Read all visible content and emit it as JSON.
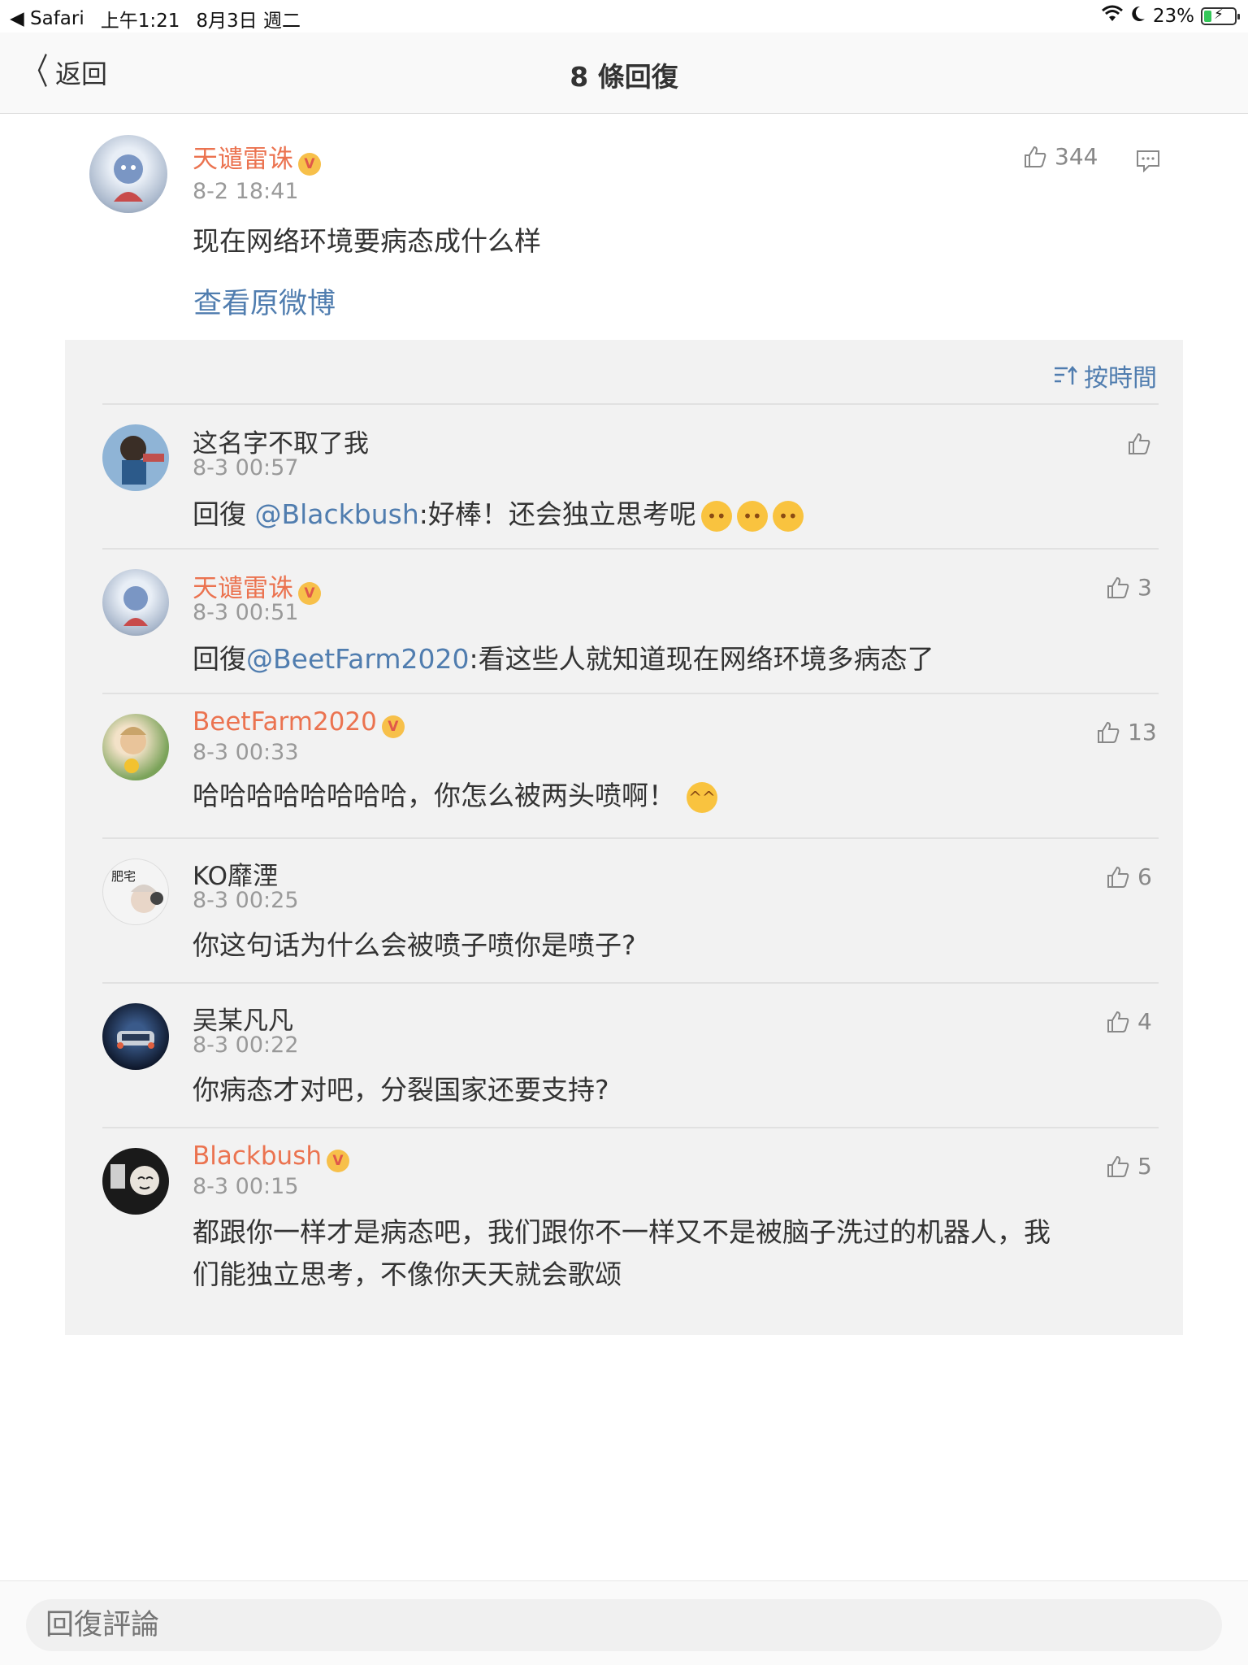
{
  "statusbar": {
    "app_back": "◀ Safari",
    "time": "上午1:21",
    "date": "8月3日 週二",
    "battery": "23%"
  },
  "nav": {
    "back_label": "返回",
    "title": "8 條回復"
  },
  "main_comment": {
    "name": "天谴雷诛",
    "time": "8-2 18:41",
    "text": "现在网络环境要病态成什么样",
    "likes": "344",
    "view_original": "查看原微博"
  },
  "sort_label": "按時間",
  "replies": [
    {
      "name": "这名字不取了我",
      "time": "8-3 00:57",
      "prefix": "回復 ",
      "at": "@Blackbush",
      "text": ":好棒！还会独立思考呢",
      "likes": "",
      "orange": false
    },
    {
      "name": "天谴雷诛",
      "time": "8-3 00:51",
      "prefix": "回復",
      "at": "@BeetFarm2020",
      "text": ":看这些人就知道现在网络环境多病态了",
      "likes": "3",
      "orange": true
    },
    {
      "name": "BeetFarm2020",
      "time": "8-3 00:33",
      "text": "哈哈哈哈哈哈哈哈，你怎么被两头喷啊！",
      "likes": "13",
      "orange": true
    },
    {
      "name": "KO靡湮",
      "time": "8-3 00:25",
      "text": "你这句话为什么会被喷子喷你是喷子?",
      "likes": "6",
      "orange": false
    },
    {
      "name": "吴某凡凡",
      "time": "8-3 00:22",
      "text": "你病态才对吧，分裂国家还要支持?",
      "likes": "4",
      "orange": false
    },
    {
      "name": "Blackbush",
      "time": "8-3 00:15",
      "text_line1": "都跟你一样才是病态吧，我们跟你不一样又不是被脑子洗过的机器人，我",
      "text_line2": "们能独立思考，不像你天天就会歌颂",
      "likes": "5",
      "orange": true
    }
  ],
  "input_placeholder": "回復評論"
}
